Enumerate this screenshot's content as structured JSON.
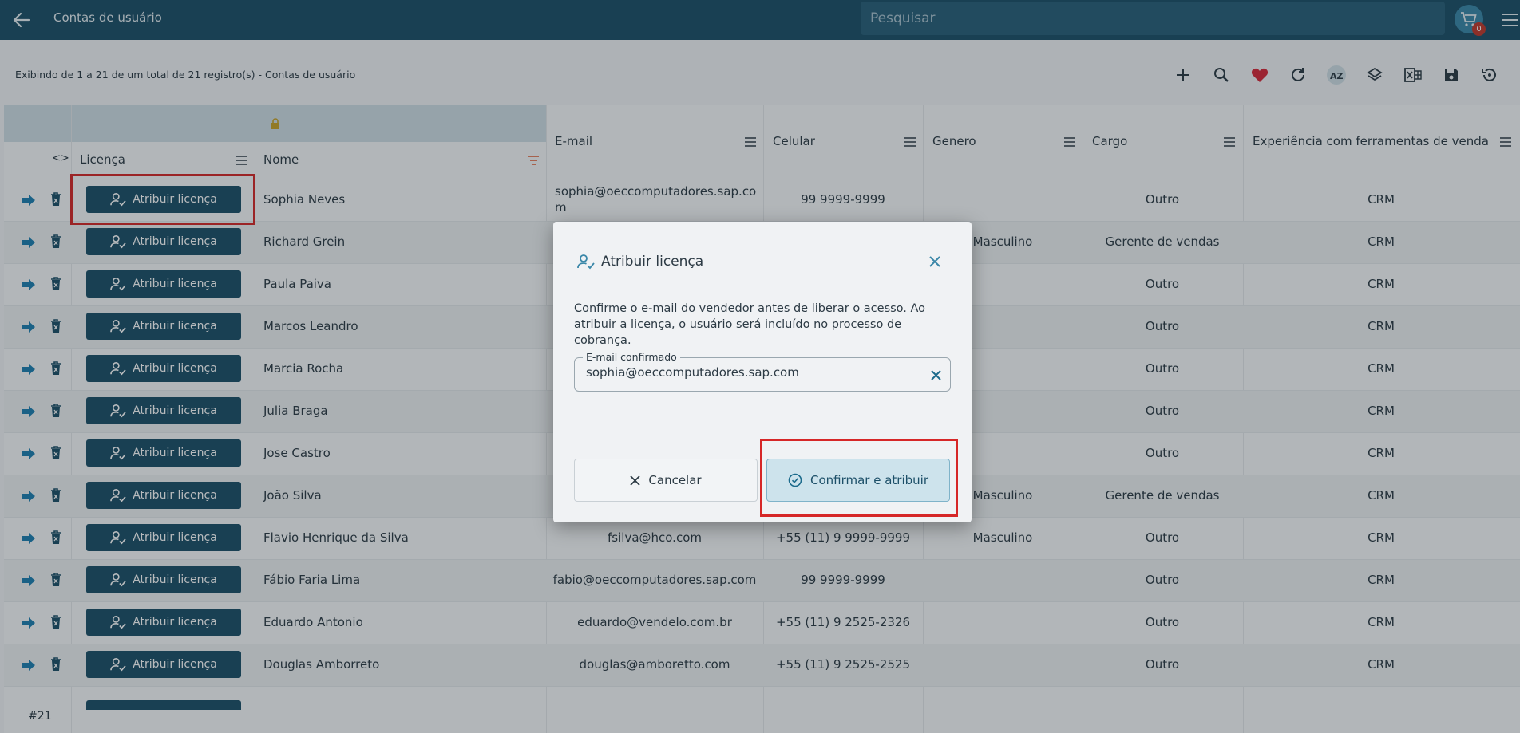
{
  "topbar": {
    "title": "Contas de usuário",
    "search_placeholder": "Pesquisar",
    "cart_count": "0",
    "back_icon": "arrow-left-icon",
    "menu_icon": "hamburger-icon"
  },
  "toolbar": {
    "records_text": "Exibindo de 1 a 21 de um total de 21 registro(s) - Contas de usuário",
    "icons": [
      "plus-icon",
      "search-icon",
      "heart-icon",
      "refresh-icon",
      "sort-az-icon",
      "layers-icon",
      "excel-icon",
      "save-icon",
      "history-icon"
    ]
  },
  "table": {
    "headers": {
      "code": "<>",
      "license": "Licença",
      "name": "Nome",
      "email": "E-mail",
      "phone": "Celular",
      "gender": "Genero",
      "role": "Cargo",
      "experience": "Experiência com ferramentas de venda"
    },
    "license_button_label": "Atribuir licença",
    "rows": [
      {
        "name": "Sophia  Neves",
        "email": "sophia@oeccomputadores.sap.co",
        "email2": "m",
        "phone": "99 9999-9999",
        "gender": "",
        "role": "Outro",
        "exp": "CRM"
      },
      {
        "name": "Richard  Grein",
        "email": "",
        "email2": "",
        "phone": "",
        "gender": "Masculino",
        "role": "Gerente de vendas",
        "exp": "CRM"
      },
      {
        "name": "Paula  Paiva",
        "email": "",
        "email2": "",
        "phone": "",
        "gender": "",
        "role": "Outro",
        "exp": "CRM"
      },
      {
        "name": "Marcos  Leandro",
        "email": "",
        "email2": "",
        "phone": "",
        "gender": "",
        "role": "Outro",
        "exp": "CRM"
      },
      {
        "name": "Marcia  Rocha",
        "email": "",
        "email2": "",
        "phone": "",
        "gender": "",
        "role": "Outro",
        "exp": "CRM"
      },
      {
        "name": "Julia  Braga",
        "email": "",
        "email2": "",
        "phone": "",
        "gender": "",
        "role": "Outro",
        "exp": "CRM"
      },
      {
        "name": "Jose  Castro",
        "email": "",
        "email2": "",
        "phone": "",
        "gender": "",
        "role": "Outro",
        "exp": "CRM"
      },
      {
        "name": "João  Silva",
        "email": "",
        "email2": "",
        "phone": "",
        "gender": "Masculino",
        "role": "Gerente de vendas",
        "exp": "CRM"
      },
      {
        "name": "Flavio Henrique da Silva",
        "email": "fsilva@hco.com",
        "email2": "",
        "phone": "+55 (11) 9 9999-9999",
        "gender": "Masculino",
        "role": "Outro",
        "exp": "CRM"
      },
      {
        "name": "Fábio Faria Lima",
        "email": "fabio@oeccomputadores.sap.com",
        "email2": "",
        "phone": "99 9999-9999",
        "gender": "",
        "role": "Outro",
        "exp": "CRM"
      },
      {
        "name": "Eduardo  Antonio",
        "email": "eduardo@vendelo.com.br",
        "email2": "",
        "phone": "+55 (11) 9 2525-2326",
        "gender": "",
        "role": "Outro",
        "exp": "CRM"
      },
      {
        "name": "Douglas  Amborreto",
        "email": "douglas@amboretto.com",
        "email2": "",
        "phone": "+55 (11) 9 2525-2525",
        "gender": "",
        "role": "Outro",
        "exp": "CRM"
      }
    ],
    "footer_count": "#21"
  },
  "dialog": {
    "title": "Atribuir licença",
    "text": "Confirme o e-mail do vendedor antes de liberar o acesso. Ao atribuir a licença, o usuário será incluído no processo de cobrança.",
    "field_label": "E-mail confirmado",
    "field_value": "sophia@oeccomputadores.sap.com",
    "cancel_label": "Cancelar",
    "confirm_label": "Confirmar e atribuir"
  },
  "colors": {
    "primary": "#1c4f68",
    "highlight": "#d62727",
    "heart": "#d62839"
  }
}
